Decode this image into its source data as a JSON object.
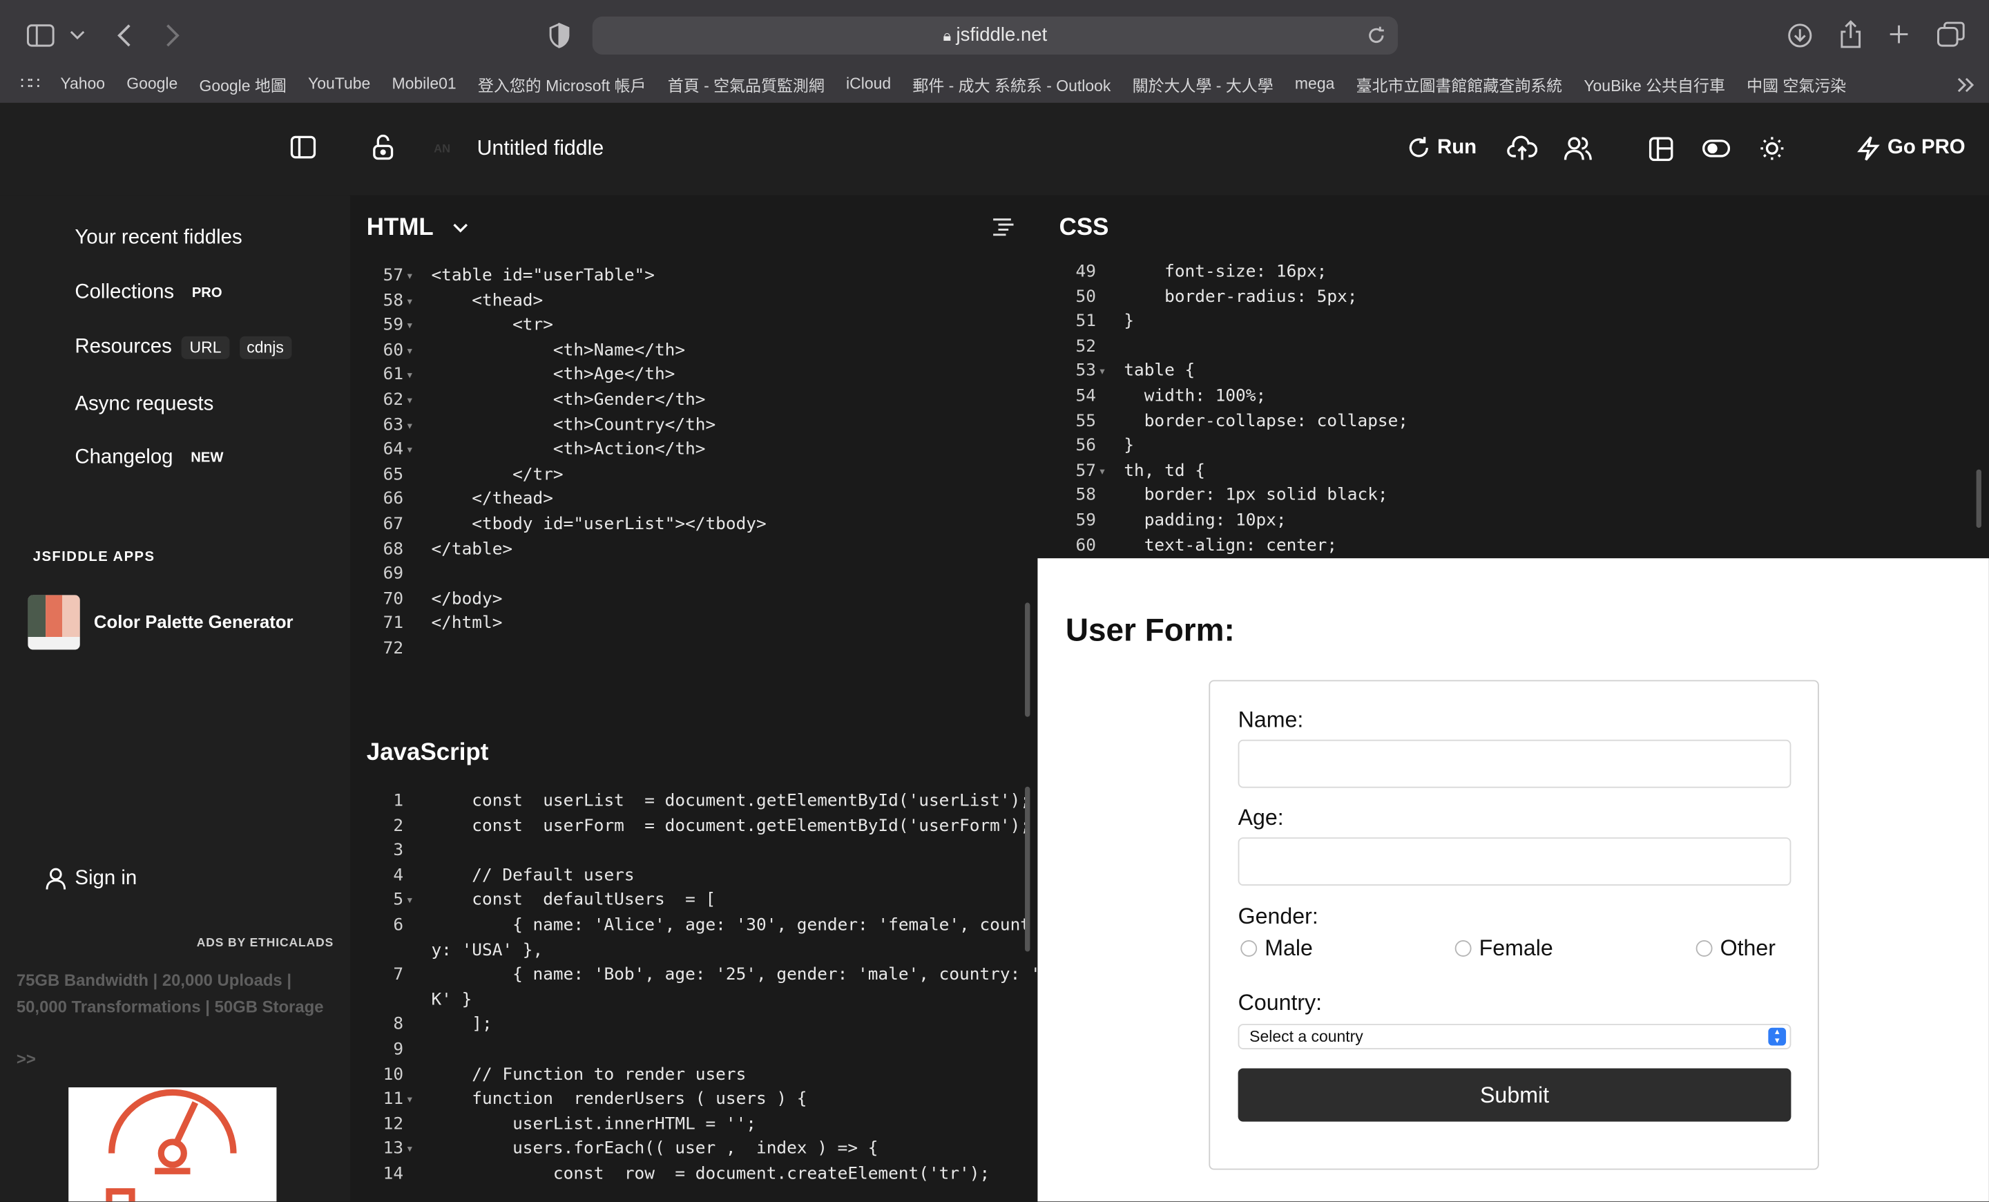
{
  "browser": {
    "url": "jsfiddle.net",
    "bookmarks": [
      "Yahoo",
      "Google",
      "Google 地圖",
      "YouTube",
      "Mobile01",
      "登入您的 Microsoft 帳戶",
      "首頁 - 空氣品質監測網",
      "iCloud",
      "郵件 - 成大 系統系 - Outlook",
      "關於大人學 - 大人學",
      "mega",
      "臺北市立圖書館館藏查詢系統",
      "YouBike 公共自行車",
      "中國 空氣污染"
    ]
  },
  "header": {
    "user_initials": "AN",
    "fiddle_title": "Untitled fiddle",
    "run_label": "Run",
    "gopro_label": "Go PRO"
  },
  "sidebar": {
    "recent": "Your recent fiddles",
    "collections": "Collections",
    "collections_badge": "PRO",
    "resources": "Resources",
    "resources_url": "URL",
    "resources_cdnjs": "cdnjs",
    "async": "Async requests",
    "changelog": "Changelog",
    "changelog_badge": "NEW",
    "apps_heading": "JSFIDDLE APPS",
    "app_name": "Color Palette Generator",
    "sign_in": "Sign in",
    "ads_label": "ADS BY ETHICALADS",
    "ad_text": "75GB Bandwidth | 20,000 Uploads | 50,000 Transformations | 50GB Storage",
    "ad_more": ">>"
  },
  "html_panel": {
    "title": "HTML",
    "lines": [
      {
        "n": "57",
        "fold": true,
        "code": "<table id=\"userTable\">"
      },
      {
        "n": "58",
        "fold": true,
        "code": "    <thead>"
      },
      {
        "n": "59",
        "fold": true,
        "code": "        <tr>"
      },
      {
        "n": "60",
        "fold": true,
        "code": "            <th>Name</th>"
      },
      {
        "n": "61",
        "fold": true,
        "code": "            <th>Age</th>"
      },
      {
        "n": "62",
        "fold": true,
        "code": "            <th>Gender</th>"
      },
      {
        "n": "63",
        "fold": true,
        "code": "            <th>Country</th>"
      },
      {
        "n": "64",
        "fold": true,
        "code": "            <th>Action</th>"
      },
      {
        "n": "65",
        "fold": false,
        "code": "        </tr>"
      },
      {
        "n": "66",
        "fold": false,
        "code": "    </thead>"
      },
      {
        "n": "67",
        "fold": false,
        "code": "    <tbody id=\"userList\"></tbody>"
      },
      {
        "n": "68",
        "fold": false,
        "code": "</table>"
      },
      {
        "n": "69",
        "fold": false,
        "code": ""
      },
      {
        "n": "70",
        "fold": false,
        "code": "</body>"
      },
      {
        "n": "71",
        "fold": false,
        "code": "</html>"
      },
      {
        "n": "72",
        "fold": false,
        "code": ""
      }
    ]
  },
  "css_panel": {
    "title": "CSS",
    "lines": [
      {
        "n": "49",
        "fold": false,
        "code": "    font-size: 16px;"
      },
      {
        "n": "50",
        "fold": false,
        "code": "    border-radius: 5px;"
      },
      {
        "n": "51",
        "fold": false,
        "code": "}"
      },
      {
        "n": "52",
        "fold": false,
        "code": ""
      },
      {
        "n": "53",
        "fold": true,
        "code": "table {"
      },
      {
        "n": "54",
        "fold": false,
        "code": "  width: 100%;"
      },
      {
        "n": "55",
        "fold": false,
        "code": "  border-collapse: collapse;"
      },
      {
        "n": "56",
        "fold": false,
        "code": "}"
      },
      {
        "n": "57",
        "fold": true,
        "code": "th, td {"
      },
      {
        "n": "58",
        "fold": false,
        "code": "  border: 1px solid black;"
      },
      {
        "n": "59",
        "fold": false,
        "code": "  padding: 10px;"
      },
      {
        "n": "60",
        "fold": false,
        "code": "  text-align: center;"
      }
    ]
  },
  "js_panel": {
    "title": "JavaScript",
    "lines": [
      {
        "n": "1",
        "fold": false,
        "code": "    const  userList  = document.getElementById('userList');"
      },
      {
        "n": "2",
        "fold": false,
        "code": "    const  userForm  = document.getElementById('userForm');"
      },
      {
        "n": "3",
        "fold": false,
        "code": ""
      },
      {
        "n": "4",
        "fold": false,
        "code": "    // Default users"
      },
      {
        "n": "5",
        "fold": true,
        "code": "    const  defaultUsers  = ["
      },
      {
        "n": "6",
        "fold": false,
        "code": "        { name: 'Alice', age: '30', gender: 'female', count"
      },
      {
        "n": "",
        "fold": false,
        "code": "y: 'USA' },"
      },
      {
        "n": "7",
        "fold": false,
        "code": "        { name: 'Bob', age: '25', gender: 'male', country: '"
      },
      {
        "n": "",
        "fold": false,
        "code": "K' }"
      },
      {
        "n": "8",
        "fold": false,
        "code": "    ];"
      },
      {
        "n": "9",
        "fold": false,
        "code": ""
      },
      {
        "n": "10",
        "fold": false,
        "code": "    // Function to render users"
      },
      {
        "n": "11",
        "fold": true,
        "code": "    function  renderUsers ( users ) {"
      },
      {
        "n": "12",
        "fold": false,
        "code": "        userList.innerHTML = '';"
      },
      {
        "n": "13",
        "fold": true,
        "code": "        users.forEach(( user ,  index ) => {"
      },
      {
        "n": "14",
        "fold": false,
        "code": "            const  row  = document.createElement('tr');"
      }
    ]
  },
  "preview": {
    "heading": "User Form:",
    "name_label": "Name:",
    "age_label": "Age:",
    "gender_label": "Gender:",
    "gender_options": [
      "Male",
      "Female",
      "Other"
    ],
    "country_label": "Country:",
    "country_selected": "Select a country",
    "submit_label": "Submit"
  },
  "colors": {
    "accent": "#0a84ff",
    "preview_button": "#2d2d2d",
    "ad_logo": "#e0553a"
  }
}
